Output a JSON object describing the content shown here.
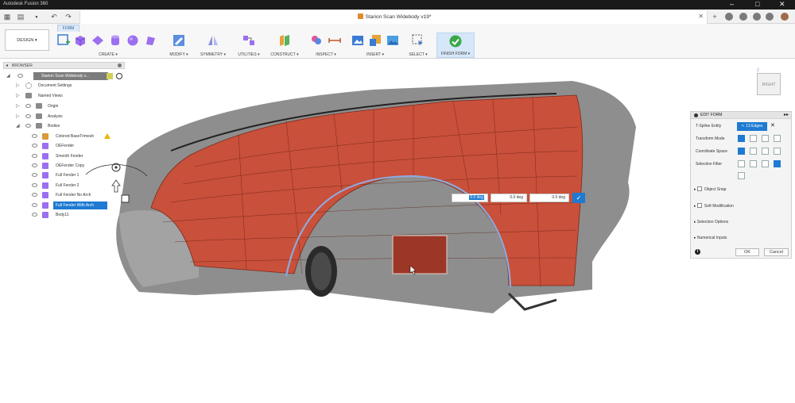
{
  "app": {
    "title": "Autodesk Fusion 360",
    "document_title": "Starion Scan Widebody v19*"
  },
  "colors": {
    "accent": "#1e7ad2",
    "tspline": "#c9503a",
    "tspline_dark": "#9c3626",
    "titlebar": "#1a1a1a"
  },
  "ribbon": {
    "workspace": "DESIGN",
    "active_tab": "FORM",
    "groups": [
      {
        "label": "CREATE ▾"
      },
      {
        "label": "MODIFY ▾"
      },
      {
        "label": "SYMMETRY ▾"
      },
      {
        "label": "UTILITIES ▾"
      },
      {
        "label": "CONSTRUCT ▾"
      },
      {
        "label": "INSPECT ▾"
      },
      {
        "label": "INSERT ▾"
      },
      {
        "label": "SELECT ▾"
      },
      {
        "label": "FINISH FORM ▾"
      }
    ]
  },
  "browser": {
    "title": "BROWSER",
    "root": "Starion Scan Widebody v...",
    "items": [
      {
        "label": "Document Settings"
      },
      {
        "label": "Named Views"
      },
      {
        "label": "Origin"
      },
      {
        "label": "Analysis"
      },
      {
        "label": "Bodies"
      }
    ],
    "bodies": [
      {
        "label": "Colored BaseTrimesh"
      },
      {
        "label": "OEFender"
      },
      {
        "label": "Smooth Fender"
      },
      {
        "label": "OEFender Copy"
      },
      {
        "label": "Full Fender 1"
      },
      {
        "label": "Full Fender 2"
      },
      {
        "label": "Full Fender No Arch"
      },
      {
        "label": "Full Fender With Arch"
      },
      {
        "label": "Body11"
      }
    ]
  },
  "transform_inputs": {
    "angle1": "0.0 deg",
    "angle2": "0.0 deg",
    "angle3": "0.0 deg"
  },
  "viewcube": {
    "face": "RIGHT"
  },
  "edit_form": {
    "title": "EDIT FORM",
    "tspline_entity_label": "T-Spline Entity",
    "selection_count": "13 Edges",
    "transform_mode_label": "Transform Mode",
    "coordinate_space_label": "Coordinate Space",
    "selection_filter_label": "Selection Filter",
    "object_snap": "Object Snap",
    "soft_modification": "Soft Modification",
    "selection_options": "Selection Options",
    "numerical_inputs": "Numerical Inputs",
    "ok": "OK",
    "cancel": "Cancel"
  }
}
